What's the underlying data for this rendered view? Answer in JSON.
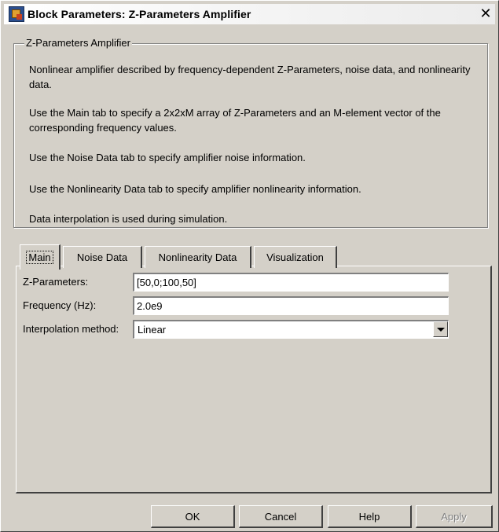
{
  "window": {
    "title": "Block Parameters: Z-Parameters Amplifier"
  },
  "group": {
    "legend": "Z-Parameters Amplifier",
    "lines": [
      "Nonlinear amplifier described by frequency-dependent Z-Parameters, noise data, and nonlinearity data.",
      "Use the Main tab to specify a 2x2xM array of Z-Parameters and an M-element vector of the corresponding frequency values.",
      "Use the Noise Data tab to specify amplifier noise information.",
      "Use the Nonlinearity Data tab to specify amplifier nonlinearity information.",
      "Data interpolation is used during simulation."
    ]
  },
  "tabs": [
    "Main",
    "Noise Data",
    "Nonlinearity Data",
    "Visualization"
  ],
  "main": {
    "z_label": "Z-Parameters:",
    "z_value": "[50,0;100,50]",
    "freq_label": "Frequency (Hz):",
    "freq_value": "2.0e9",
    "interp_label": "Interpolation method:",
    "interp_value": "Linear"
  },
  "buttons": {
    "ok": "OK",
    "cancel": "Cancel",
    "help": "Help",
    "apply": "Apply"
  }
}
